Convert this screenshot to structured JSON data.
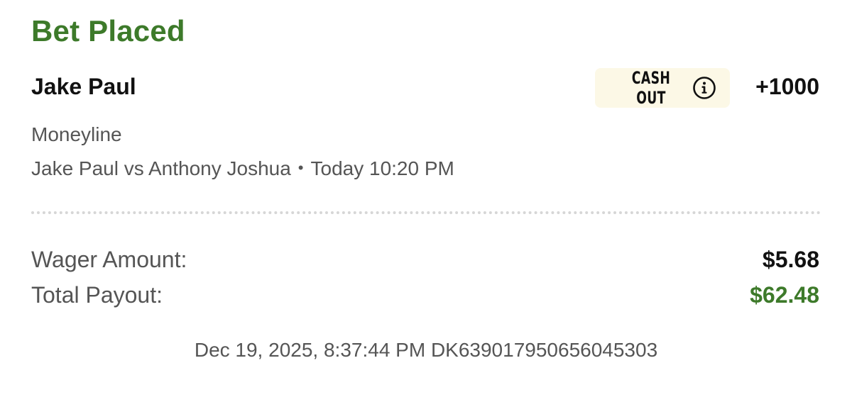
{
  "header": {
    "title": "Bet Placed"
  },
  "bet": {
    "selection": "Jake Paul",
    "cash_out_label": "CASH OUT",
    "odds": "+1000",
    "market": "Moneyline",
    "event": "Jake Paul vs Anthony Joshua",
    "event_time": "Today 10:20 PM"
  },
  "amounts": {
    "wager_label": "Wager Amount:",
    "wager_value": "$5.68",
    "payout_label": "Total Payout:",
    "payout_value": "$62.48"
  },
  "footer": {
    "timestamp_and_id": "Dec 19, 2025, 8:37:44 PM DK639017950656045303"
  },
  "colors": {
    "accent_green": "#3d7a2a",
    "cash_out_bg": "#fcf8e6"
  },
  "icons": {
    "cash_out_info": "info-icon"
  }
}
